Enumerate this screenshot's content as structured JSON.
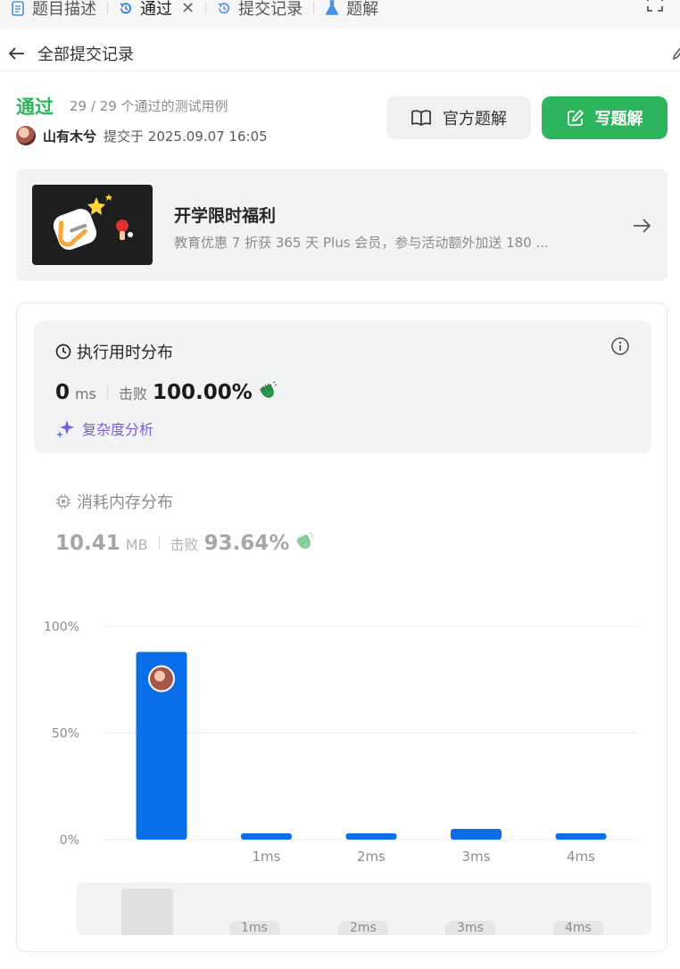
{
  "tabs": [
    {
      "label": "题目描述",
      "icon": "document-icon"
    },
    {
      "label": "通过",
      "icon": "history-icon",
      "active": true
    },
    {
      "label": "提交记录",
      "icon": "history-icon"
    },
    {
      "label": "题解",
      "icon": "flask-icon"
    }
  ],
  "header": {
    "back_label": "全部提交记录"
  },
  "result": {
    "status": "通过",
    "cases": "29 / 29 个通过的测试用例",
    "author": "山有木兮",
    "submitted": "提交于 2025.09.07 16:05",
    "official_button": "官方题解",
    "write_button": "写题解"
  },
  "promo": {
    "title": "开学限时福利",
    "description": "教育优惠 7 折获 365 天 Plus 会员，参与活动额外加送 180 ..."
  },
  "runtime": {
    "title": "执行用时分布",
    "value": "0",
    "unit": "ms",
    "beat_label": "击败",
    "percent": "100.00%",
    "complexity_label": "复杂度分析"
  },
  "memory": {
    "title": "消耗内存分布",
    "value": "10.41",
    "unit": "MB",
    "beat_label": "击败",
    "percent": "93.64%"
  },
  "chart_data": {
    "type": "bar",
    "categories": [
      "",
      "1ms",
      "2ms",
      "3ms",
      "4ms"
    ],
    "values": [
      88,
      3,
      3,
      5,
      3
    ],
    "ylim": [
      0,
      100
    ],
    "yticks": [
      "0%",
      "50%",
      "100%"
    ],
    "grid": true,
    "highlight_index": 0,
    "colors": {
      "bar": "#0a6ee8",
      "grid": "#ebebeb",
      "tick": "#8c8c8c"
    }
  },
  "overview": {
    "labels": [
      "1ms",
      "2ms",
      "3ms",
      "4ms"
    ]
  },
  "colors": {
    "accent": "#2db55d",
    "chart": "#0a6ee8",
    "purple": "#7b5ce0"
  }
}
